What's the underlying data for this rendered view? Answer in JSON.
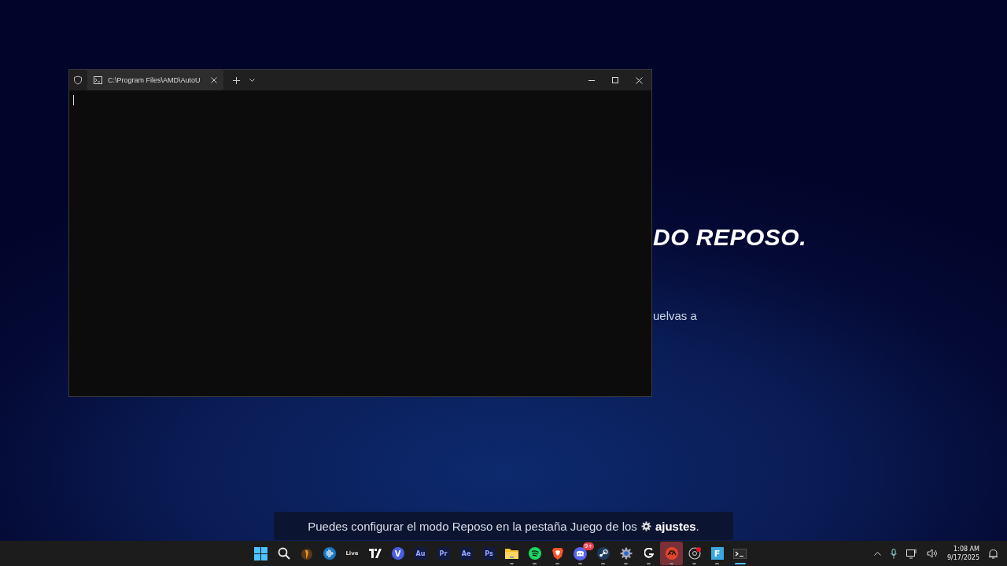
{
  "background": {
    "heading": "DO REPOSO.",
    "body": "uelvas a"
  },
  "terminal": {
    "tab_title": "C:\\Program Files\\AMD\\AutoU",
    "tab_selected": true
  },
  "toast": {
    "before": "Puedes configurar el modo Reposo en la pestaña Juego de los",
    "after": "**ajustes**."
  },
  "taskbar": {
    "apps": [
      {
        "kind": "windows",
        "running": false,
        "focused": false,
        "flashing": false
      },
      {
        "kind": "search",
        "running": false,
        "focused": false,
        "flashing": false
      },
      {
        "kind": "fruit",
        "running": false,
        "focused": false,
        "flashing": false
      },
      {
        "kind": "wave",
        "running": false,
        "focused": false,
        "flashing": false
      },
      {
        "kind": "text",
        "label": "Live",
        "running": false,
        "focused": false,
        "flashing": false
      },
      {
        "kind": "chart",
        "running": false,
        "focused": false,
        "flashing": false
      },
      {
        "kind": "circle",
        "label": "V",
        "running": false,
        "focused": false,
        "flashing": false
      },
      {
        "kind": "square",
        "label": "Au",
        "running": false,
        "focused": false,
        "flashing": false
      },
      {
        "kind": "square",
        "label": "Pr",
        "running": false,
        "focused": false,
        "flashing": false
      },
      {
        "kind": "square",
        "label": "Ae",
        "running": false,
        "focused": false,
        "flashing": false
      },
      {
        "kind": "square",
        "label": "Ps",
        "running": false,
        "focused": false,
        "flashing": false
      },
      {
        "kind": "folder",
        "running": true,
        "focused": false,
        "flashing": false
      },
      {
        "kind": "music",
        "running": true,
        "focused": false,
        "flashing": false
      },
      {
        "kind": "shield",
        "running": true,
        "focused": false,
        "flashing": false
      },
      {
        "kind": "chat",
        "badge": "9+",
        "running": true,
        "focused": false,
        "flashing": false
      },
      {
        "kind": "steam",
        "running": true,
        "focused": false,
        "flashing": false
      },
      {
        "kind": "gear",
        "running": true,
        "focused": false,
        "flashing": false
      },
      {
        "kind": "g",
        "running": true,
        "focused": false,
        "flashing": false
      },
      {
        "kind": "ea",
        "running": true,
        "focused": false,
        "flashing": true
      },
      {
        "kind": "recorder",
        "running": true,
        "focused": false,
        "flashing": false
      },
      {
        "kind": "letter",
        "label": "F",
        "running": true,
        "focused": false,
        "flashing": false
      },
      {
        "kind": "terminal",
        "running": true,
        "focused": true,
        "flashing": false
      }
    ],
    "time": "1:08 AM",
    "date": "9/17/2025"
  }
}
